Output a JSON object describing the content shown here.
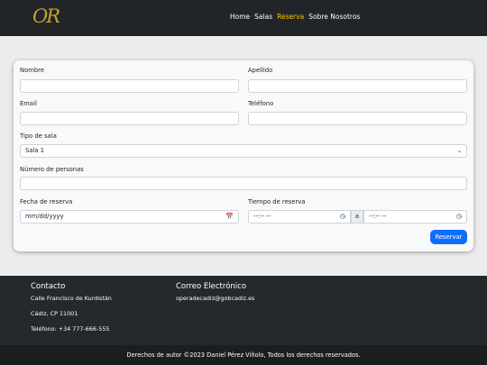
{
  "navbar": {
    "logo": "OR",
    "items": [
      "Home",
      "Salas",
      "Reserva",
      "Sobre Nosotros"
    ],
    "active_index": 2,
    "active_color": "#ffc107"
  },
  "form": {
    "nombre_label": "Nombre",
    "apellido_label": "Apellido",
    "email_label": "Email",
    "telefono_label": "Teléfono",
    "tipo_sala_label": "Tipo de sala",
    "tipo_sala_value": "Sala 1",
    "num_personas_label": "Número de personas",
    "fecha_label": "Fecha de reserva",
    "fecha_placeholder": "mm/dd/yyyy",
    "tiempo_label": "Tiempo de reserva",
    "tiempo_start_placeholder": "--:-- --",
    "tiempo_separator": "a",
    "tiempo_end_placeholder": "--:-- --",
    "submit_label": "Reservar",
    "submit_color": "#0d6efd"
  },
  "footer": {
    "contacto_title": "Contacto",
    "address": "Calle Francisco de Kurdistán",
    "city": "Cádiz, CP 11001",
    "phone": "Teléfono: +34 777-666-555",
    "correo_title": "Correo Electrónico",
    "email": "operadecadiz@gobcadiz.es",
    "copyright": "Derechos de autor ©2023 Daniel Pérez Viñolo, Todos los derechos reservados."
  }
}
